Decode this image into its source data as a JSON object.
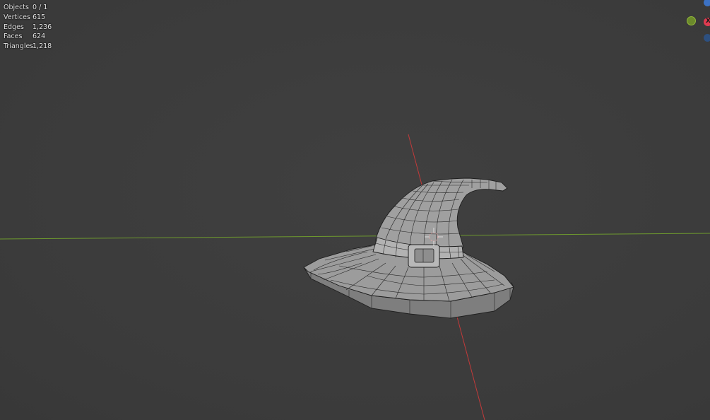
{
  "viewport": {
    "background_color": "#3d3d3d",
    "x_axis_color": "#c23a3a",
    "y_axis_color": "#6e9a2e",
    "mesh_color": "#9a9a9a",
    "wire_color": "#222222"
  },
  "statistics": [
    {
      "label": "Objects",
      "value": "0 / 1"
    },
    {
      "label": "Vertices",
      "value": "615"
    },
    {
      "label": "Edges",
      "value": "1,236"
    },
    {
      "label": "Faces",
      "value": "624"
    },
    {
      "label": "Triangles",
      "value": "1,218"
    }
  ],
  "gizmo": {
    "x_label": "X",
    "x_color": "#e03b50",
    "y_color": "#6c8a2b",
    "z_color": "#3c72c4"
  },
  "object": {
    "name_icon": "3d-cursor-icon"
  }
}
